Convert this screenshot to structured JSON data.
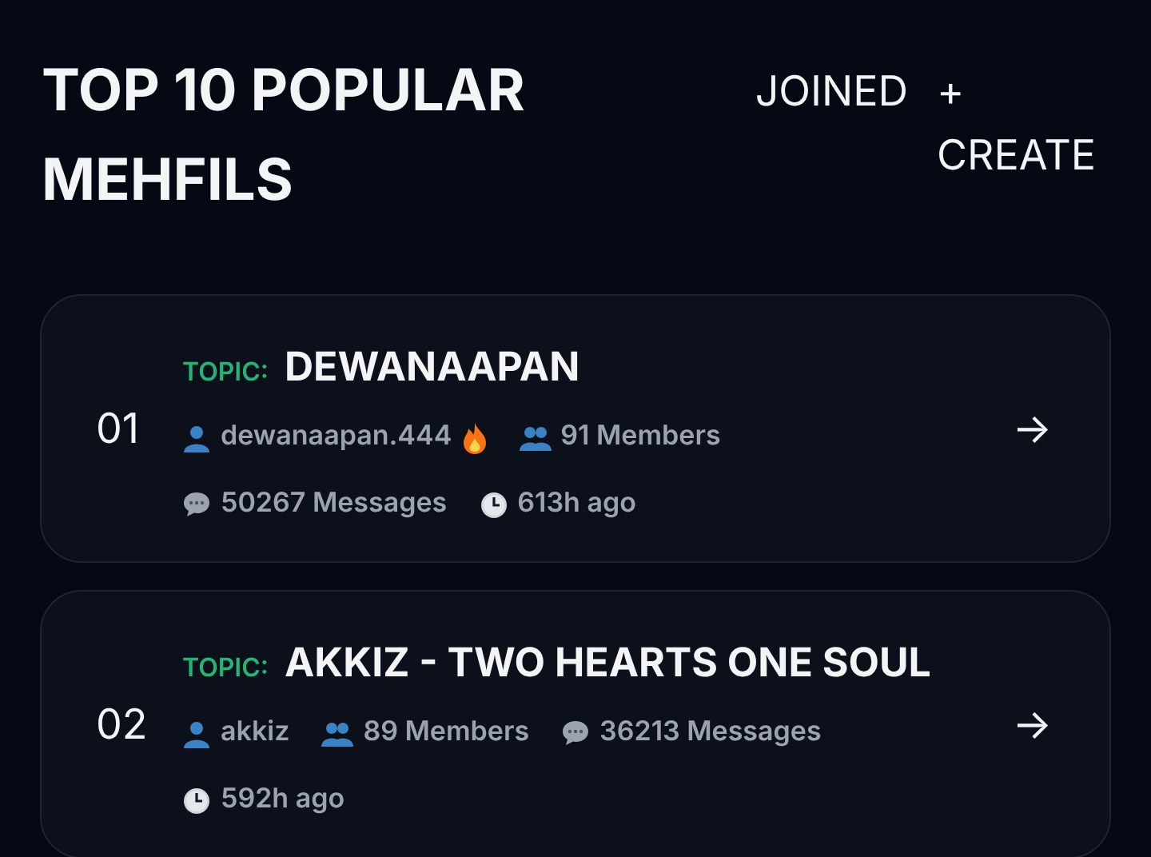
{
  "header": {
    "title": "TOP 10 POPULAR MEHFILS",
    "joined_link": "JOINED",
    "create_button": {
      "symbol": "+",
      "label": "CREATE"
    }
  },
  "mehfils": [
    {
      "rank": "01",
      "topic_label": "TOPIC:",
      "topic": "DEWANAAPAN",
      "arrow": "→",
      "meta": [
        {
          "kind": "user",
          "text": "dewanaapan.444",
          "hot": true
        },
        {
          "kind": "members",
          "text": "91 Members"
        },
        {
          "kind": "messages",
          "text": "50267 Messages"
        },
        {
          "kind": "time",
          "text": "613h ago"
        }
      ]
    },
    {
      "rank": "02",
      "topic_label": "TOPIC:",
      "topic": "AKKIZ - TWO HEARTS ONE SOUL",
      "arrow": "→",
      "meta": [
        {
          "kind": "user",
          "text": "akkiz",
          "hot": false
        },
        {
          "kind": "members",
          "text": "89 Members"
        },
        {
          "kind": "messages",
          "text": "36213 Messages"
        },
        {
          "kind": "time",
          "text": "592h ago"
        }
      ]
    }
  ]
}
